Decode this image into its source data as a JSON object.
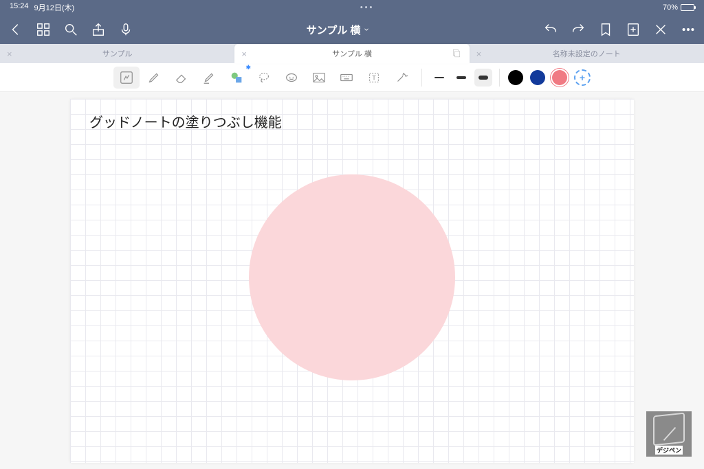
{
  "status": {
    "time": "15:24",
    "date": "9月12日(木)",
    "battery_pct": "70%"
  },
  "nav": {
    "title": "サンプル 横"
  },
  "tabs": [
    {
      "label": "サンプル",
      "active": false
    },
    {
      "label": "サンプル 横",
      "active": true
    },
    {
      "label": "名称未設定のノート",
      "active": false
    }
  ],
  "toolbar": {
    "colors": {
      "black": "#000000",
      "blue": "#123a9b",
      "pink": "#f07a83"
    },
    "strokes": {
      "thin": 2,
      "med": 4,
      "thick": 6
    }
  },
  "page_text": "グッドノートの塗りつぶし機能",
  "watermark_label": "デジペン"
}
